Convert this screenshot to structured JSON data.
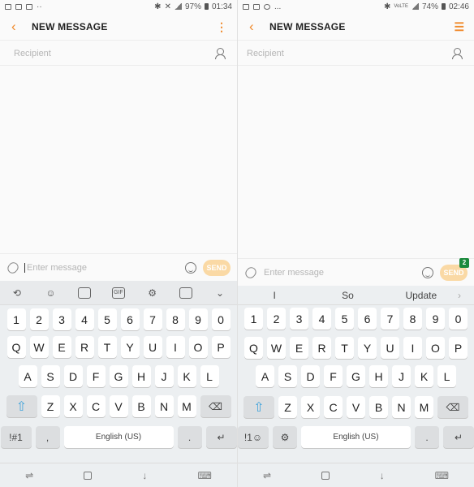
{
  "left": {
    "status": {
      "battery": "97%",
      "time": "01:34"
    },
    "header": {
      "back_icon": "back-arrow-icon",
      "title": "NEW MESSAGE",
      "menu_icon": "more-vert-icon"
    },
    "recipient": {
      "placeholder": "Recipient"
    },
    "compose": {
      "placeholder": "Enter message",
      "send_label": "SEND"
    },
    "toolbar": {
      "icons": [
        "handwriting-icon",
        "emoji-icon",
        "sticker-icon",
        "gif-icon",
        "settings-icon",
        "clipboard-icon",
        "collapse-icon"
      ]
    },
    "keys": {
      "row1": [
        "1",
        "2",
        "3",
        "4",
        "5",
        "6",
        "7",
        "8",
        "9",
        "0"
      ],
      "row2": [
        "Q",
        "W",
        "E",
        "R",
        "T",
        "Y",
        "U",
        "I",
        "O",
        "P"
      ],
      "row3": [
        "A",
        "S",
        "D",
        "F",
        "G",
        "H",
        "J",
        "K",
        "L"
      ],
      "row4": [
        "Z",
        "X",
        "C",
        "V",
        "B",
        "N",
        "M"
      ],
      "symbols": "!#1",
      "comma": ",",
      "space": "English (US)",
      "period": "."
    }
  },
  "right": {
    "status": {
      "battery": "74%",
      "time": "02:46"
    },
    "header": {
      "back_icon": "back-arrow-icon",
      "title": "NEW MESSAGE",
      "menu_icon": "menu-icon"
    },
    "recipient": {
      "placeholder": "Recipient"
    },
    "compose": {
      "placeholder": "Enter message",
      "send_label": "SEND",
      "send_badge": "2"
    },
    "suggestions": [
      "I",
      "So",
      "Update"
    ],
    "keys": {
      "row1": [
        "1",
        "2",
        "3",
        "4",
        "5",
        "6",
        "7",
        "8",
        "9",
        "0"
      ],
      "row2": [
        "Q",
        "W",
        "E",
        "R",
        "T",
        "Y",
        "U",
        "I",
        "O",
        "P"
      ],
      "row3": [
        "A",
        "S",
        "D",
        "F",
        "G",
        "H",
        "J",
        "K",
        "L"
      ],
      "row4": [
        "Z",
        "X",
        "C",
        "V",
        "B",
        "N",
        "M"
      ],
      "symbols": "!1☺",
      "space": "English (US)",
      "period": "."
    }
  },
  "colors": {
    "accent": "#f0892a",
    "send_disabled": "#fad9a5",
    "shift": "#3ea2db",
    "badge": "#1b8a3c"
  }
}
